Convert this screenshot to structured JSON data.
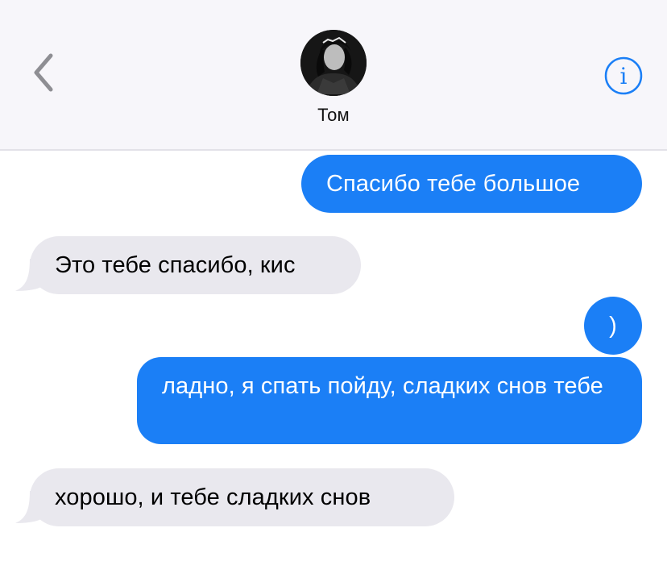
{
  "header": {
    "contact_name": "Том",
    "back_icon": "chevron-left-icon",
    "info_icon": "info-icon",
    "accent_color": "#1b7ff6"
  },
  "messages": [
    {
      "direction": "outgoing",
      "text": "Спасибо тебе большое"
    },
    {
      "direction": "incoming",
      "text": "Это тебе спасибо, кис"
    },
    {
      "direction": "outgoing",
      "text": ")"
    },
    {
      "direction": "outgoing",
      "text": "ладно, я спать пойду, сладких снов тебе"
    },
    {
      "direction": "incoming",
      "text": "хорошо, и тебе сладких снов"
    }
  ],
  "colors": {
    "outgoing_bubble": "#1b7ff6",
    "incoming_bubble": "#e9e8ee",
    "header_background": "#f7f6fa"
  }
}
